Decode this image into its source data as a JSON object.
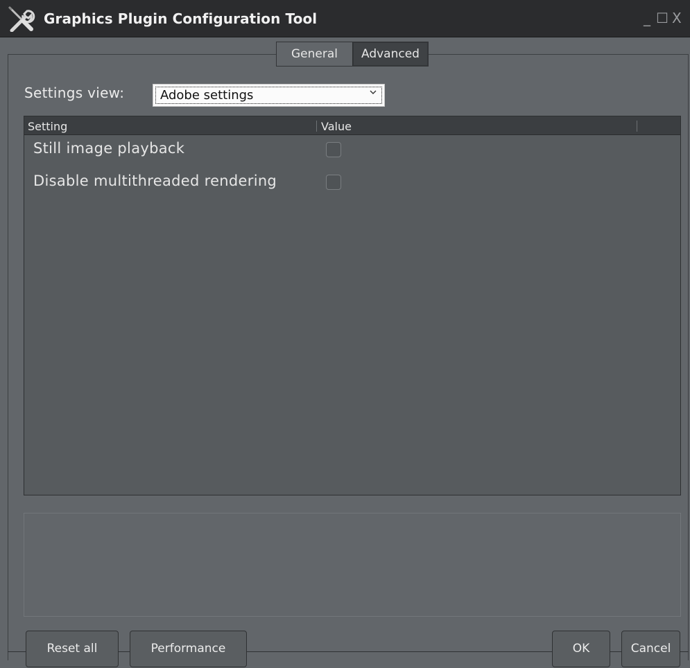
{
  "window": {
    "title": "Graphics Plugin Configuration Tool",
    "controls": {
      "minimize": "_",
      "maximize": "☐",
      "close": "X"
    }
  },
  "tabs": [
    {
      "label": "General",
      "active": false
    },
    {
      "label": "Advanced",
      "active": true
    }
  ],
  "settings_view": {
    "label": "Settings view:",
    "selected": "Adobe settings"
  },
  "table": {
    "columns": [
      "Setting",
      "Value"
    ],
    "rows": [
      {
        "label": "Still image playback",
        "checked": false
      },
      {
        "label": "Disable multithreaded rendering",
        "checked": false
      }
    ]
  },
  "buttons": {
    "reset_all": "Reset all",
    "performance": "Performance",
    "ok": "OK",
    "cancel": "Cancel"
  },
  "colors": {
    "titlebar": "#2b2c2e",
    "window_bg": "#62666a",
    "table_bg": "#575b5e",
    "header_bg": "#3b3e41"
  },
  "icons": {
    "app": "tools-icon"
  }
}
